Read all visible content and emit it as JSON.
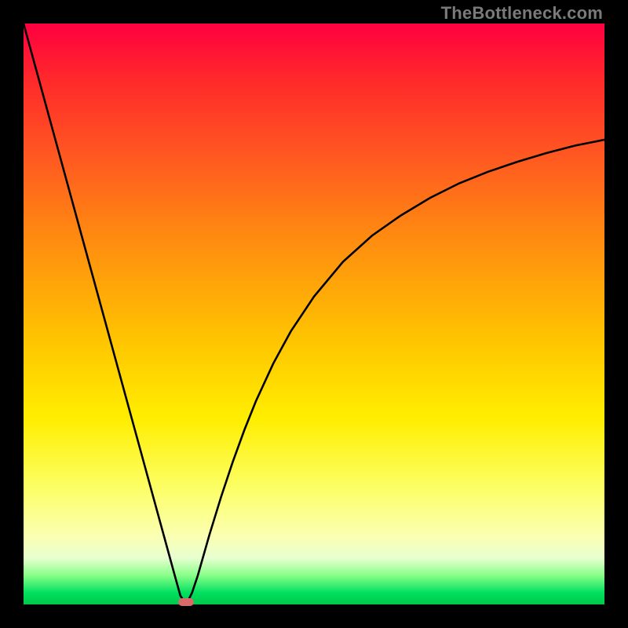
{
  "watermark": "TheBottleneck.com",
  "chart_data": {
    "type": "line",
    "title": "",
    "xlabel": "",
    "ylabel": "",
    "xlim": [
      0,
      100
    ],
    "ylim": [
      0,
      100
    ],
    "x": [
      0,
      2,
      4,
      6,
      8,
      10,
      12,
      14,
      16,
      18,
      20,
      22,
      24,
      26,
      27,
      28,
      29,
      30,
      32,
      34,
      36,
      38,
      40,
      43,
      46,
      50,
      55,
      60,
      65,
      70,
      75,
      80,
      85,
      90,
      95,
      100
    ],
    "values": [
      100,
      92.7,
      85.4,
      78.1,
      70.8,
      63.5,
      56.2,
      48.9,
      41.6,
      34.3,
      27.0,
      19.7,
      12.4,
      5.1,
      1.5,
      0.0,
      2.0,
      5.0,
      12.0,
      18.5,
      24.5,
      30.0,
      35.0,
      41.5,
      47.0,
      53.0,
      59.0,
      63.5,
      67.0,
      70.0,
      72.5,
      74.5,
      76.2,
      77.7,
      79.0,
      80.0
    ],
    "curve_note": "V-shaped bottleneck curve with minimum near x≈28",
    "marker": {
      "x": 28,
      "y": 0,
      "color": "#d86a6a"
    },
    "background_gradient": [
      "#ff0040",
      "#ff5522",
      "#ffc600",
      "#ffee00",
      "#00c84a"
    ]
  }
}
